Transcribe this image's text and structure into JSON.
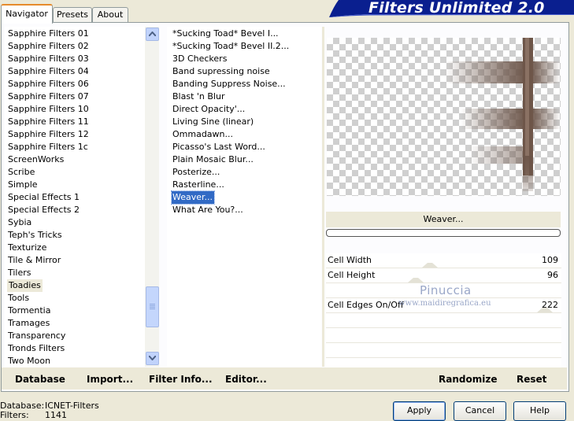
{
  "tabs": [
    {
      "label": "Navigator",
      "active": true
    },
    {
      "label": "Presets",
      "active": false
    },
    {
      "label": "About",
      "active": false
    }
  ],
  "brand": {
    "title": "Filters Unlimited 2.0",
    "color": "#0a1f8f"
  },
  "categories": {
    "items": [
      "Sapphire Filters 01",
      "Sapphire Filters 02",
      "Sapphire Filters 03",
      "Sapphire Filters 04",
      "Sapphire Filters 06",
      "Sapphire Filters 07",
      "Sapphire Filters 10",
      "Sapphire Filters 11",
      "Sapphire Filters 12",
      "Sapphire Filters 1c",
      "ScreenWorks",
      "Scribe",
      "Simple",
      "Special Effects 1",
      "Special Effects 2",
      "Sybia",
      "Teph's Tricks",
      "Texturize",
      "Tile & Mirror",
      "Tilers",
      "Toadies",
      "Tools",
      "Tormentia",
      "Tramages",
      "Transparency",
      "Tronds Filters",
      "Two Moon"
    ],
    "selected": "Toadies"
  },
  "filters": {
    "items": [
      "*Sucking Toad*  Bevel I...",
      "*Sucking Toad*  Bevel II.2...",
      "3D Checkers",
      "Band supressing noise",
      "Banding Suppress Noise...",
      "Blast 'n Blur",
      "Direct Opacity'...",
      "Living Sine (linear)",
      "Ommadawn...",
      "Picasso's Last Word...",
      "Plain Mosaic Blur...",
      "Posterize...",
      "Rasterline...",
      "Weaver...",
      "What Are You?..."
    ],
    "selected": "Weaver..."
  },
  "preview": {
    "filter_name": "Weaver...",
    "progress": 0
  },
  "params": [
    {
      "name": "Cell Width",
      "value": "109"
    },
    {
      "name": "Cell Height",
      "value": "96"
    },
    {
      "name": "",
      "value": ""
    },
    {
      "name": "Cell Edges On/Off",
      "value": "222"
    },
    {
      "name": "",
      "value": ""
    },
    {
      "name": "",
      "value": ""
    },
    {
      "name": "",
      "value": ""
    },
    {
      "name": "",
      "value": ""
    }
  ],
  "watermark": {
    "name": "Pinuccia",
    "site": "www.maidiregrafica.eu"
  },
  "bottom_links": {
    "database": "Database",
    "import": "Import...",
    "filter_info": "Filter Info...",
    "editor": "Editor...",
    "randomize": "Randomize",
    "reset": "Reset"
  },
  "status": {
    "database_label": "Database:",
    "database_value": "ICNET-Filters",
    "filters_label": "Filters:",
    "filters_value": "1141"
  },
  "buttons": {
    "apply": "Apply",
    "cancel": "Cancel",
    "help": "Help"
  }
}
